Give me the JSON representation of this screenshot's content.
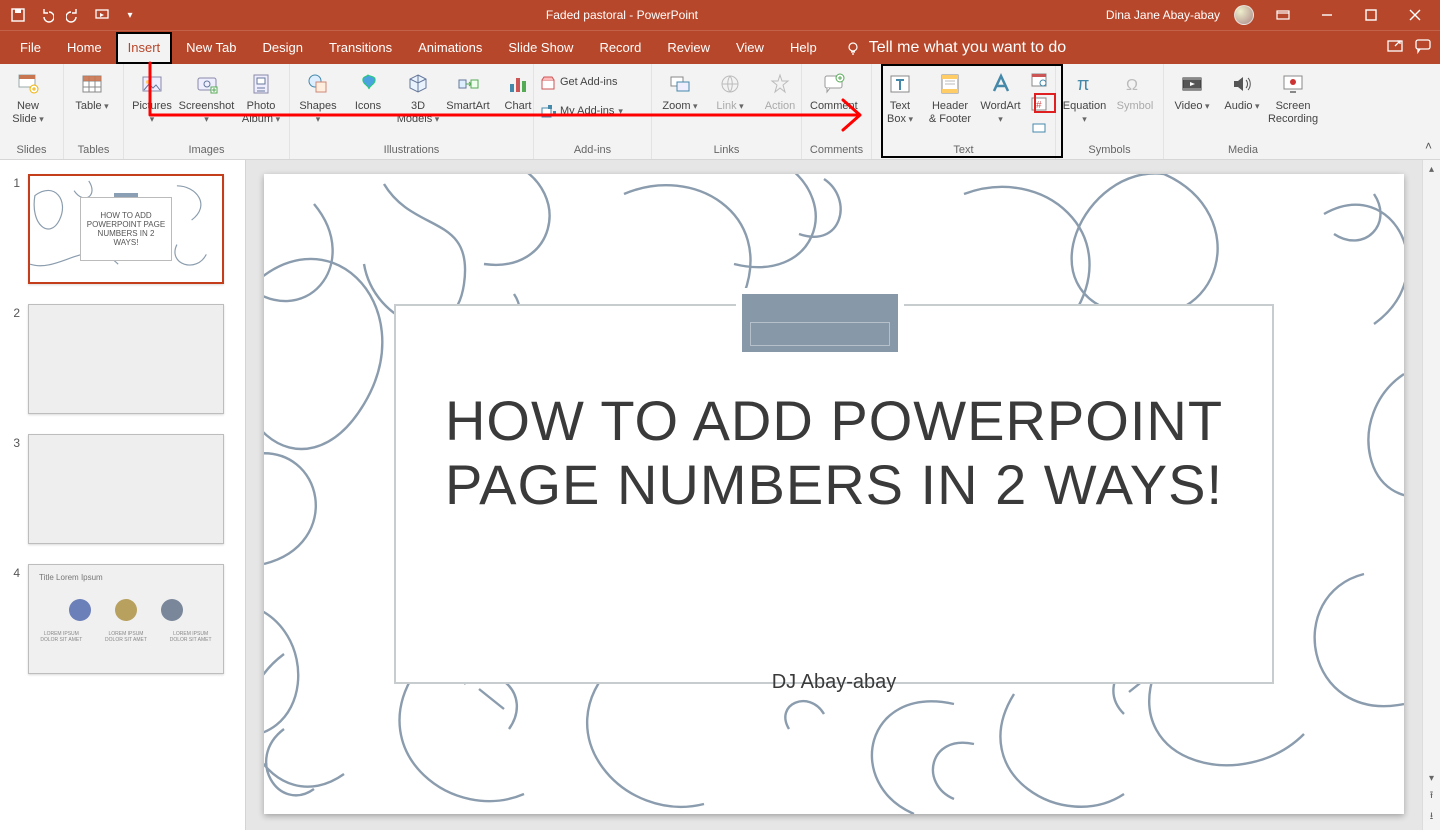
{
  "titlebar": {
    "document": "Faded pastoral",
    "app": "PowerPoint",
    "sep": "  -  ",
    "user": "Dina Jane Abay-abay"
  },
  "tabs": {
    "file": "File",
    "home": "Home",
    "insert": "Insert",
    "newtab": "New Tab",
    "design": "Design",
    "transitions": "Transitions",
    "animations": "Animations",
    "slideshow": "Slide Show",
    "record": "Record",
    "review": "Review",
    "view": "View",
    "help": "Help",
    "tellme": "Tell me what you want to do"
  },
  "ribbon": {
    "slides": {
      "new_slide": "New\nSlide",
      "group": "Slides"
    },
    "tables": {
      "table": "Table",
      "group": "Tables"
    },
    "images": {
      "pictures": "Pictures",
      "screenshot": "Screenshot",
      "photo_album": "Photo\nAlbum",
      "group": "Images"
    },
    "illustrations": {
      "shapes": "Shapes",
      "icons": "Icons",
      "models": "3D\nModels",
      "smartart": "SmartArt",
      "chart": "Chart",
      "group": "Illustrations"
    },
    "addins": {
      "get": "Get Add-ins",
      "my": "My Add-ins",
      "group": "Add-ins"
    },
    "links": {
      "zoom": "Zoom",
      "link": "Link",
      "action": "Action",
      "group": "Links"
    },
    "comments": {
      "comment": "Comment",
      "group": "Comments"
    },
    "text": {
      "textbox": "Text\nBox",
      "header": "Header\n& Footer",
      "wordart": "WordArt",
      "group": "Text"
    },
    "symbols": {
      "equation": "Equation",
      "symbol": "Symbol",
      "group": "Symbols"
    },
    "media": {
      "video": "Video",
      "audio": "Audio",
      "screenrec": "Screen\nRecording",
      "group": "Media"
    }
  },
  "panel": {
    "nums": [
      "1",
      "2",
      "3",
      "4"
    ],
    "slide1_title": "HOW TO ADD\nPOWERPOINT PAGE\nNUMBERS IN 2 WAYS!",
    "slide4_title": "Title Lorem Ipsum",
    "slide4_caption": "LOREM IPSUM DOLOR SIT AMET"
  },
  "slide": {
    "title": "HOW TO ADD POWERPOINT PAGE NUMBERS IN 2 WAYS!",
    "subtitle": "DJ Abay-abay"
  }
}
